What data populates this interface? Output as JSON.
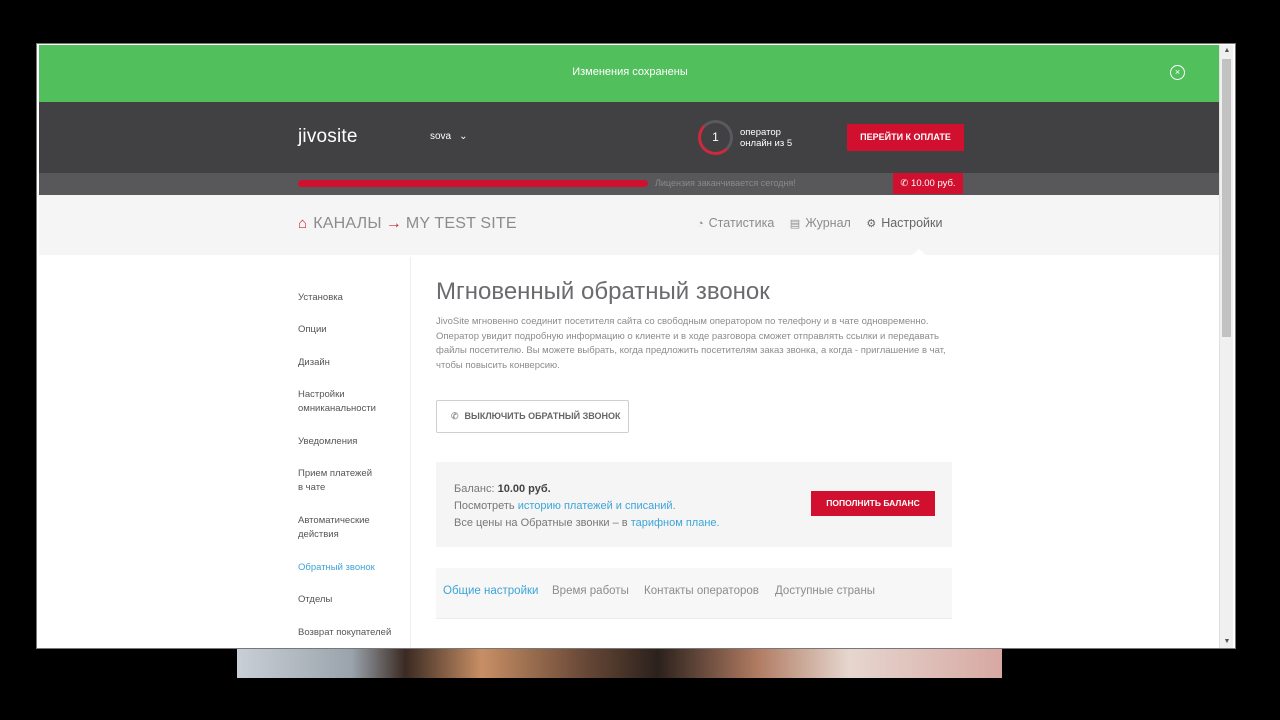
{
  "notice": {
    "message": "Изменения сохранены",
    "close_icon": "×"
  },
  "header": {
    "logo": "jivosite",
    "site": "sova",
    "operators_count": "1",
    "operators_line1": "оператор",
    "operators_line2": "онлайн из 5",
    "pay_button": "ПЕРЕЙТИ К ОПЛАТЕ"
  },
  "license": {
    "message": "Лицензия заканчивается сегодня!",
    "balance_badge": "10.00 руб.",
    "progress": 1.0
  },
  "breadcrumb": {
    "home": "⌂",
    "channels": "КАНАЛЫ",
    "arrow": "→",
    "site": "MY TEST SITE"
  },
  "nav": {
    "stats": "Статистика",
    "journal": "Журнал",
    "settings": "Настройки"
  },
  "sidebar": {
    "items": [
      "Установка",
      "Опции",
      "Дизайн",
      "Настройки",
      "омниканальности",
      "Уведомления",
      "Прием платежей",
      "в чате",
      "Автоматические",
      "действия",
      "Обратный звонок",
      "Отделы",
      "Возврат покупателей"
    ]
  },
  "main": {
    "title": "Мгновенный обратный звонок",
    "description": "JivoSite мгновенно соединит посетителя сайта со свободным оператором по телефону и в чате одновременно. Оператор увидит подробную информацию о клиенте и в ходе разговора сможет отправлять ссылки и передавать файлы посетителю. Вы можете выбрать, когда предложить посетителям заказ звонка, а когда - приглашение в чат, чтобы повысить конверсию.",
    "disable_button": "ВЫКЛЮЧИТЬ ОБРАТНЫЙ ЗВОНОК"
  },
  "balance": {
    "label": "Баланс:",
    "value": "10.00 руб.",
    "history_prefix": "Посмотреть",
    "history_link": "историю платежей и списаний.",
    "prices_prefix": "Все цены на Обратные звонки – в",
    "prices_link": "тарифном плане.",
    "topup_button": "ПОПОЛНИТЬ БАЛАНС"
  },
  "tabs": [
    "Общие настройки",
    "Время работы",
    "Контакты операторов",
    "Доступные страны"
  ],
  "colors": {
    "green": "#52bf5d",
    "red": "#d0102e",
    "dark": "#414144",
    "link": "#3da4d8"
  }
}
